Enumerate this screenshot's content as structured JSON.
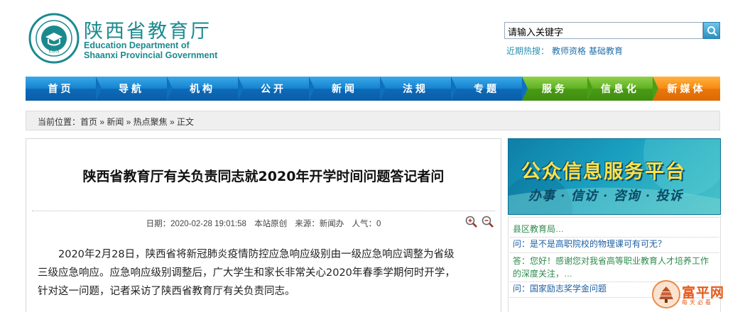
{
  "header": {
    "title_cn": "陕西省教育厅",
    "title_en_line1": "Education Department of",
    "title_en_line2": "Shaanxi Provincial Government",
    "logo_label": "EDS",
    "search": {
      "value": "请输入关键字"
    },
    "hot": {
      "label": "近期热搜：",
      "keywords": [
        "教师资格",
        "基础教育"
      ]
    }
  },
  "nav": {
    "items": [
      {
        "label": "首页",
        "color": "#1681cf"
      },
      {
        "label": "导航",
        "color": "#1681cf"
      },
      {
        "label": "机构",
        "color": "#1681cf"
      },
      {
        "label": "公开",
        "color": "#1681cf"
      },
      {
        "label": "新闻",
        "color": "#1681cf"
      },
      {
        "label": "法规",
        "color": "#1681cf"
      },
      {
        "label": "专题",
        "color": "#1681cf"
      },
      {
        "label": "服务",
        "color": "#5eb023"
      },
      {
        "label": "信息化",
        "color": "#5eb023"
      },
      {
        "label": "新媒体",
        "color": "#f68a12"
      }
    ]
  },
  "breadcrumb": {
    "text": "当前位置：首页 » 新闻 » 热点聚焦 » 正文"
  },
  "article": {
    "title": "陕西省教育厅有关负责同志就2020年开学时间问题答记者问",
    "meta": {
      "date": "日期：2020-02-28 19:01:58",
      "source1": "本站原创",
      "source2": "来源：新闻办",
      "views": "人气：0"
    },
    "paragraph_lines": [
      "2020年2月28日，陕西省将新冠肺炎疫情防控应急响应级别由一级应急响应调整为省级",
      "三级应急响应。应急响应级别调整后，广大学生和家长非常关心2020年春季学期何时开学，",
      "针对这一问题，记者采访了陕西省教育厅有关负责同志。"
    ]
  },
  "banner": {
    "title": "公众信息服务平台",
    "subtitle": "办事 · 信访 · 咨询 · 投诉"
  },
  "qa": {
    "items": [
      {
        "text": "县区教育局…",
        "kind": "a"
      },
      {
        "text": "问：是不是高职院校的物理课可有可无？",
        "kind": "q"
      },
      {
        "text": "答：您好！感谢您对我省高等职业教育人才培养工作",
        "kind": "a"
      },
      {
        "text": "的深度关注，…",
        "kind": "a"
      },
      {
        "text": "问：国家励志奖学金问题",
        "kind": "q"
      }
    ]
  },
  "watermark": {
    "text": "富平网",
    "sub": "每天必看"
  }
}
